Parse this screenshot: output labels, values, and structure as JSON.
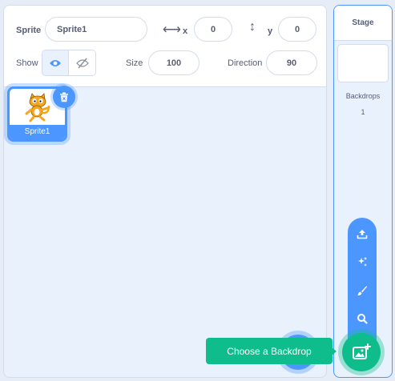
{
  "sprite_info": {
    "sprite_label": "Sprite",
    "sprite_name": "Sprite1",
    "x_label": "x",
    "x_value": "0",
    "y_label": "y",
    "y_value": "0",
    "show_label": "Show",
    "size_label": "Size",
    "size_value": "100",
    "direction_label": "Direction",
    "direction_value": "90"
  },
  "sprites": [
    {
      "name": "Sprite1",
      "selected": true
    }
  ],
  "stage": {
    "title": "Stage",
    "backdrops_label": "Backdrops",
    "backdrops_count": "1"
  },
  "backdrop_menu": {
    "items": [
      "upload-icon",
      "surprise-icon",
      "paint-icon",
      "search-icon"
    ],
    "tooltip": "Choose a Backdrop"
  },
  "colors": {
    "accent": "#4c97ff",
    "add_backdrop": "#0fbd8c",
    "text": "#575e75",
    "sprite_orange": "#f7a51c"
  }
}
